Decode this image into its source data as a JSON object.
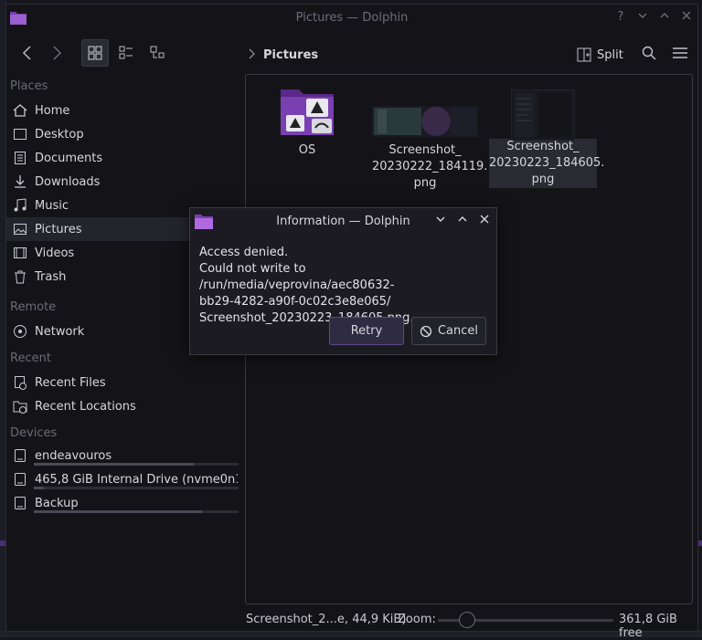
{
  "window": {
    "title": "Pictures — Dolphin"
  },
  "toolbar": {
    "breadcrumb": "Pictures",
    "split_label": "Split"
  },
  "sidebar": {
    "places_label": "Places",
    "places": [
      {
        "label": "Home",
        "icon": "home-icon"
      },
      {
        "label": "Desktop",
        "icon": "desktop-icon"
      },
      {
        "label": "Documents",
        "icon": "documents-icon"
      },
      {
        "label": "Downloads",
        "icon": "downloads-icon"
      },
      {
        "label": "Music",
        "icon": "music-icon"
      },
      {
        "label": "Pictures",
        "icon": "pictures-icon",
        "selected": true
      },
      {
        "label": "Videos",
        "icon": "videos-icon"
      },
      {
        "label": "Trash",
        "icon": "trash-icon"
      }
    ],
    "remote_label": "Remote",
    "remote": [
      {
        "label": "Network",
        "icon": "network-icon"
      }
    ],
    "recent_label": "Recent",
    "recent": [
      {
        "label": "Recent Files",
        "icon": "recent-files-icon"
      },
      {
        "label": "Recent Locations",
        "icon": "recent-locations-icon"
      }
    ],
    "devices_label": "Devices",
    "devices": [
      {
        "label": "endeavouros",
        "icon": "drive-icon",
        "usage": 0.78
      },
      {
        "label": "465,8 GiB Internal Drive (nvme0n1...",
        "icon": "drive-icon",
        "usage": 0.05
      },
      {
        "label": "Backup",
        "icon": "drive-icon",
        "usage": 0.82
      }
    ]
  },
  "files": [
    {
      "name": "OS",
      "kind": "folder"
    },
    {
      "name_lines": [
        "Screenshot_",
        "20230222_184119.",
        "png"
      ],
      "kind": "image"
    },
    {
      "name_lines": [
        "Screenshot_",
        "20230223_184605.",
        "png"
      ],
      "kind": "image",
      "selected": true
    }
  ],
  "status": {
    "selection": "Screenshot_2...e, 44,9 KiB)",
    "zoom_label": "Zoom:",
    "free_space": "361,8 GiB free",
    "zoom_level": 0.2,
    "space_used": 0.3
  },
  "dialog": {
    "title": "Information — Dolphin",
    "message_lines": [
      "Access denied.",
      "Could not write to /run/media/veprovina/aec80632-",
      "bb29-4282-a90f-0c02c3e8e065/",
      "Screenshot_20230223_184605.png."
    ],
    "retry_label": "Retry",
    "cancel_label": "Cancel"
  },
  "colors": {
    "accent": "#7a3fb0",
    "folder": "#6a2f9a",
    "selection": "#2a2a33"
  }
}
